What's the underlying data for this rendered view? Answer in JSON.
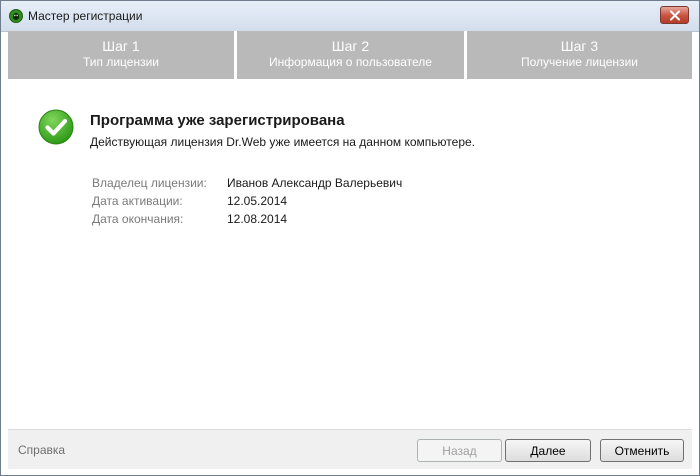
{
  "window": {
    "title": "Мастер регистрации"
  },
  "steps": [
    {
      "number": "Шаг 1",
      "title": "Тип лицензии"
    },
    {
      "number": "Шаг 2",
      "title": "Информация о пользователе"
    },
    {
      "number": "Шаг 3",
      "title": "Получение лицензии"
    }
  ],
  "main": {
    "heading": "Программа уже зарегистрирована",
    "subtext": "Действующая лицензия Dr.Web уже имеется на данном компьютере.",
    "details": [
      {
        "label": "Владелец лицензии:",
        "value": "Иванов Александр Валерьевич"
      },
      {
        "label": "Дата активации:",
        "value": "12.05.2014"
      },
      {
        "label": "Дата окончания:",
        "value": "12.08.2014"
      }
    ]
  },
  "footer": {
    "help": "Справка",
    "back": "Назад",
    "next": "Далее",
    "cancel": "Отменить"
  },
  "colors": {
    "steps_bg": "#b9b9b9",
    "check_green": "#3aa51f",
    "close_red": "#c8523f"
  },
  "icons": {
    "app": "drweb-spider-icon",
    "close": "close-icon",
    "status": "checkmark-icon"
  }
}
